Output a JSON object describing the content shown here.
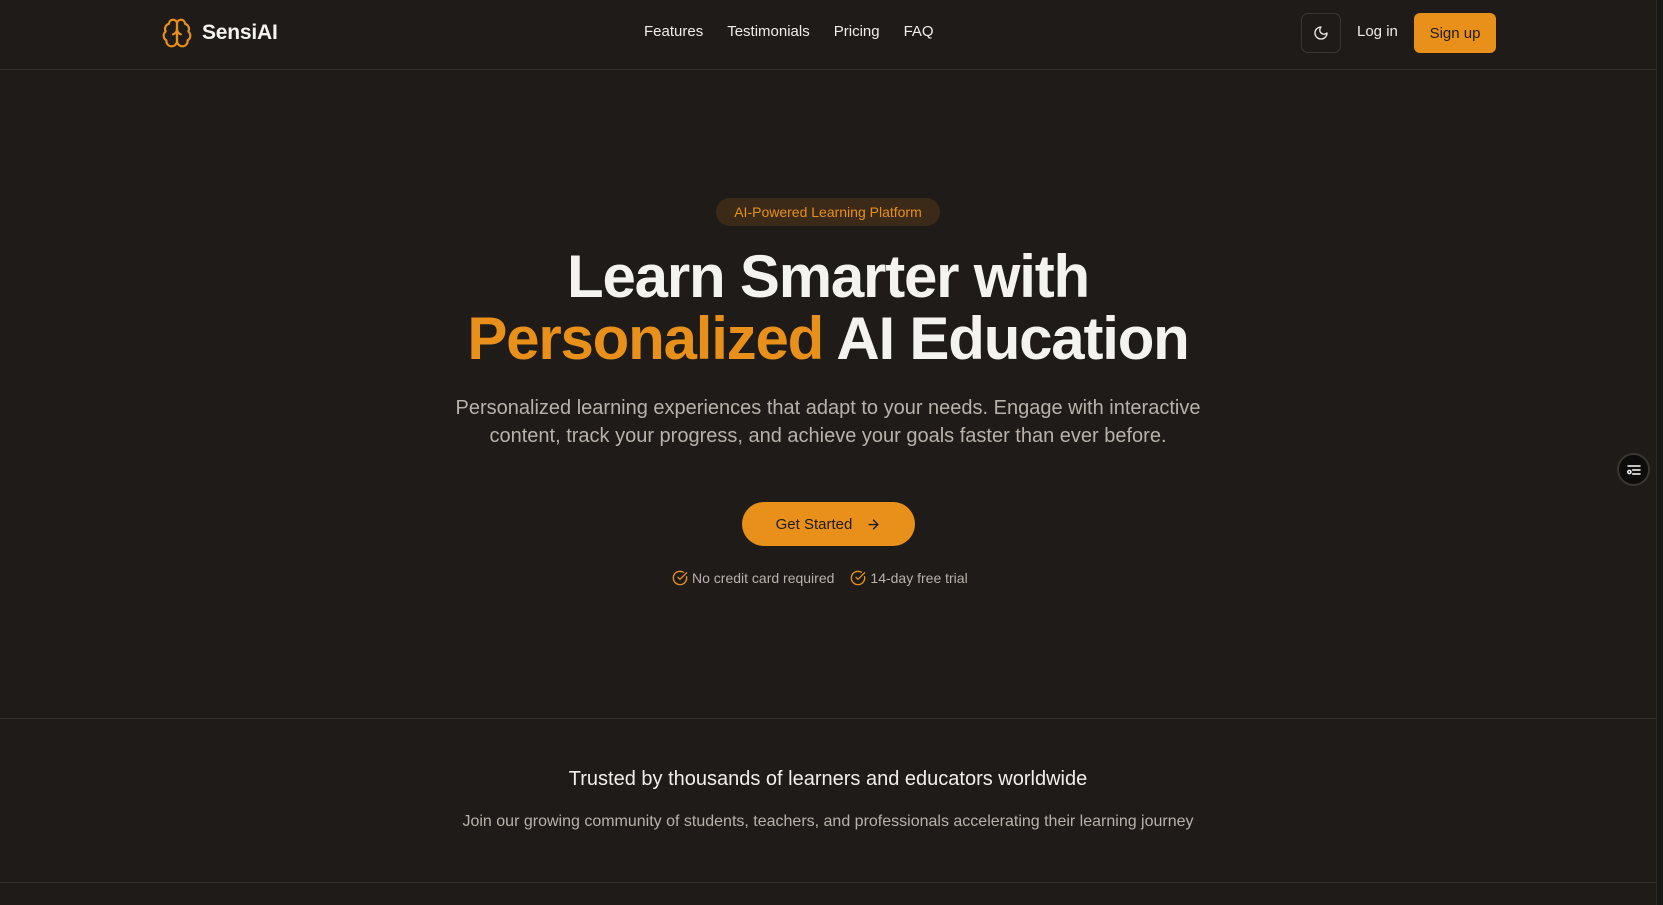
{
  "brand": {
    "name": "SensiAI",
    "icon": "brain-icon",
    "accent_color": "#e8901a"
  },
  "nav": {
    "items": [
      {
        "label": "Features"
      },
      {
        "label": "Testimonials"
      },
      {
        "label": "Pricing"
      },
      {
        "label": "FAQ"
      }
    ]
  },
  "header_actions": {
    "theme_icon": "moon-icon",
    "login_label": "Log in",
    "signup_label": "Sign up"
  },
  "hero": {
    "badge": "AI-Powered Learning Platform",
    "headline_line1": "Learn Smarter with",
    "headline_accent": "Personalized",
    "headline_line2_rest": " AI Education",
    "subtitle": "Personalized learning experiences that adapt to your needs. Engage with interactive content, track your progress, and achieve your goals faster than ever before.",
    "cta_label": "Get Started",
    "cta_icon": "arrow-right-icon",
    "perks": [
      {
        "icon": "check-circle-icon",
        "label": "No credit card required"
      },
      {
        "icon": "check-circle-icon",
        "label": "14-day free trial"
      }
    ]
  },
  "social_proof": {
    "title": "Trusted by thousands of learners and educators worldwide",
    "subtitle": "Join our growing community of students, teachers, and professionals accelerating their learning journey"
  },
  "side_widget": {
    "icon": "filter-list-icon"
  }
}
